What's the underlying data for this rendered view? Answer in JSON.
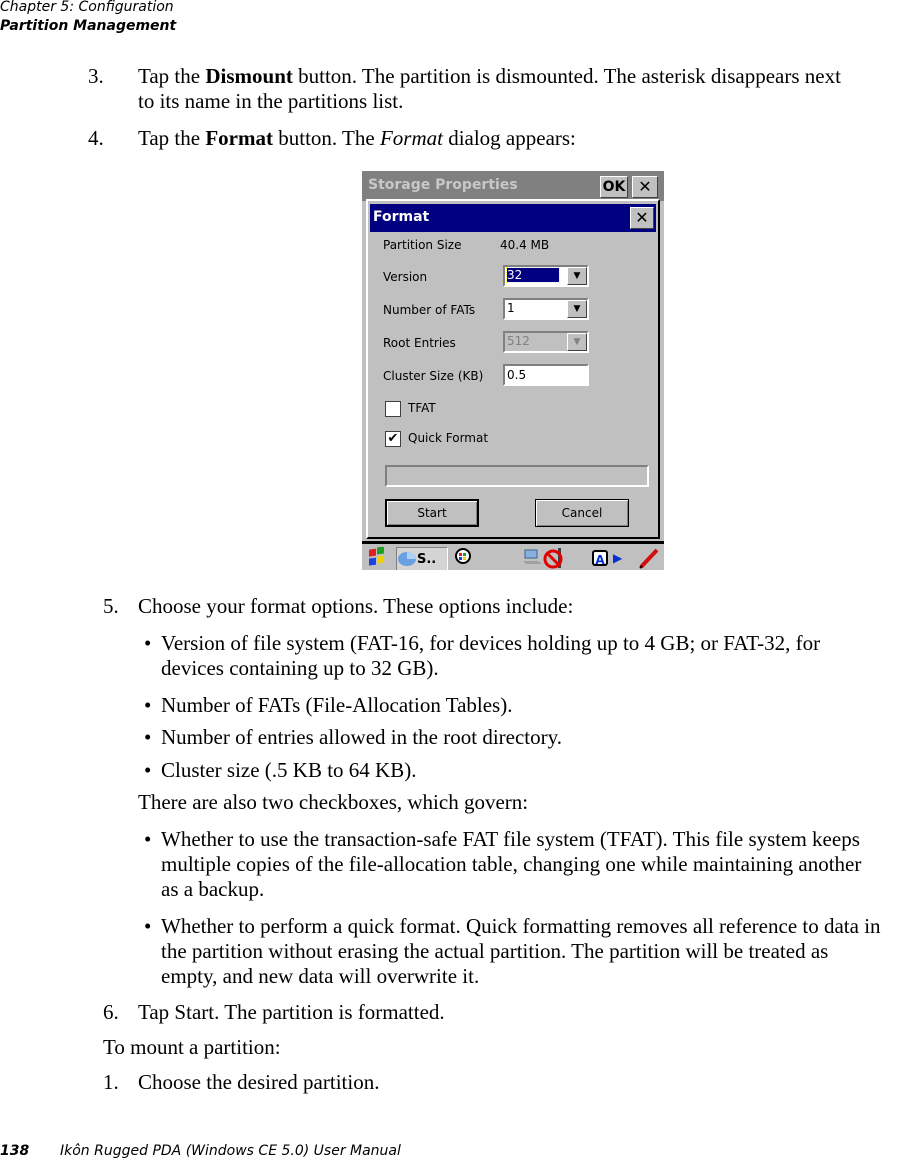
{
  "header": {
    "chapter": "Chapter 5:  Configuration",
    "section": "Partition Management"
  },
  "steps_top": [
    {
      "num": "3.",
      "pre": "Tap the ",
      "bold": "Dismount",
      "post": " button. The partition is dismounted. The asterisk disappears next",
      "line2": "to its name in the partitions list."
    },
    {
      "num": "4.",
      "pre": "Tap the ",
      "bold": "Format",
      "mid": " button. The ",
      "italic": "Format",
      "post": " dialog appears:"
    }
  ],
  "screenshot": {
    "outer_title": "Storage Properties",
    "ok_label": "OK",
    "close_glyph": "✕",
    "dialog_title": "Format",
    "fields": {
      "partition_size_label": "Partition Size",
      "partition_size_value": "40.4 MB",
      "version_label": "Version",
      "version_value": "32",
      "fats_label": "Number of FATs",
      "fats_value": "1",
      "root_label": "Root Entries",
      "root_value": "512",
      "cluster_label": "Cluster Size (KB)",
      "cluster_value": "0.5"
    },
    "checkboxes": [
      {
        "label": "TFAT",
        "checked": false
      },
      {
        "label": "Quick Format",
        "checked": true
      }
    ],
    "check_glyph": "✔",
    "arrow_glyph": "▼",
    "start_label": "Start",
    "cancel_label": "Cancel",
    "taskbar": {
      "start_icon": "windows-flag-icon",
      "task_label": "S..",
      "tray_icons": [
        "network-icon",
        "no-signal-icon",
        "input-a-icon",
        "arrow-right-icon",
        "pen-icon"
      ],
      "input_glyph": "A",
      "arrow_glyph": "▶"
    }
  },
  "step5": {
    "num": "5.",
    "text": "Choose your format options. These options include:",
    "bullets": [
      [
        "Version of file system (FAT-16, for devices holding up to 4 GB; or FAT-32, for",
        "devices containing up to 32 GB)."
      ],
      [
        "Number of FATs (File-Allocation Tables)."
      ],
      [
        "Number of entries allowed in the root directory."
      ],
      [
        "Cluster size (.5 KB to 64 KB)."
      ]
    ],
    "checkbox_intro": "There are also two checkboxes, which govern:",
    "checkbox_bullets": [
      [
        "Whether to use the transaction-safe FAT file system (TFAT). This file system keeps",
        "multiple copies of the file-allocation table, changing one while maintaining another",
        "as a backup."
      ],
      [
        "Whether to perform a quick format. Quick formatting removes all reference to data in",
        "the partition without erasing the actual partition. The partition will be treated as",
        "empty, and new data will overwrite it."
      ]
    ]
  },
  "step6": {
    "num": "6.",
    "text": "Tap Start. The partition is formatted."
  },
  "mount_intro": "To mount a partition:",
  "mount_step1": {
    "num": "1.",
    "text": "Choose the desired partition."
  },
  "footer": {
    "page_number": "138",
    "manual_title": "Ikôn Rugged PDA (Windows CE 5.0) User Manual"
  }
}
